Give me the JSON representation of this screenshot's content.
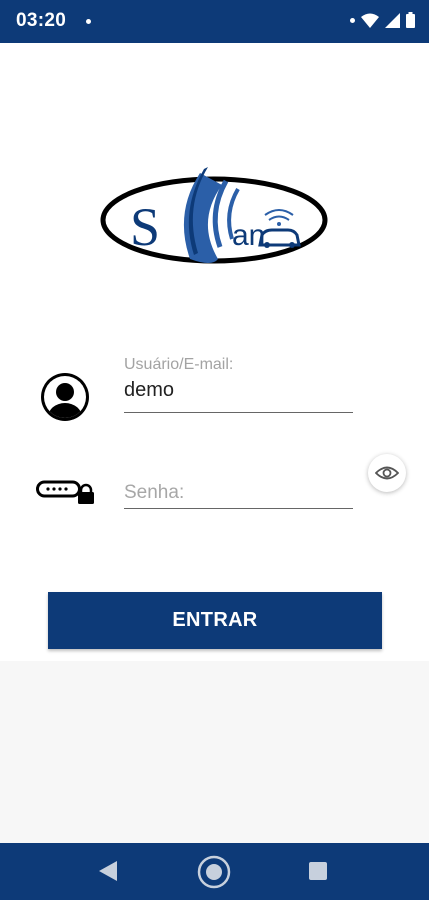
{
  "status_bar": {
    "time": "03:20",
    "icons": [
      "notification-dot-icon",
      "wifi-icon",
      "signal-icon",
      "battery-icon"
    ]
  },
  "logo": {
    "text_start": "S",
    "text_end": "an"
  },
  "login_form": {
    "username": {
      "label": "Usuário/E-mail:",
      "value": "demo",
      "icon": "avatar-icon"
    },
    "password": {
      "placeholder": "Senha:",
      "value": "",
      "icon": "password-lock-icon",
      "toggle_icon": "eye-icon"
    },
    "submit_label": "ENTRAR"
  },
  "navigation_bar": {
    "buttons": [
      "back-icon",
      "home-icon",
      "recents-icon"
    ]
  },
  "colors": {
    "primary": "#0d3a78",
    "logo_blue": "#2b5fa8",
    "background": "#ffffff",
    "footer_background": "#f7f7f7"
  }
}
